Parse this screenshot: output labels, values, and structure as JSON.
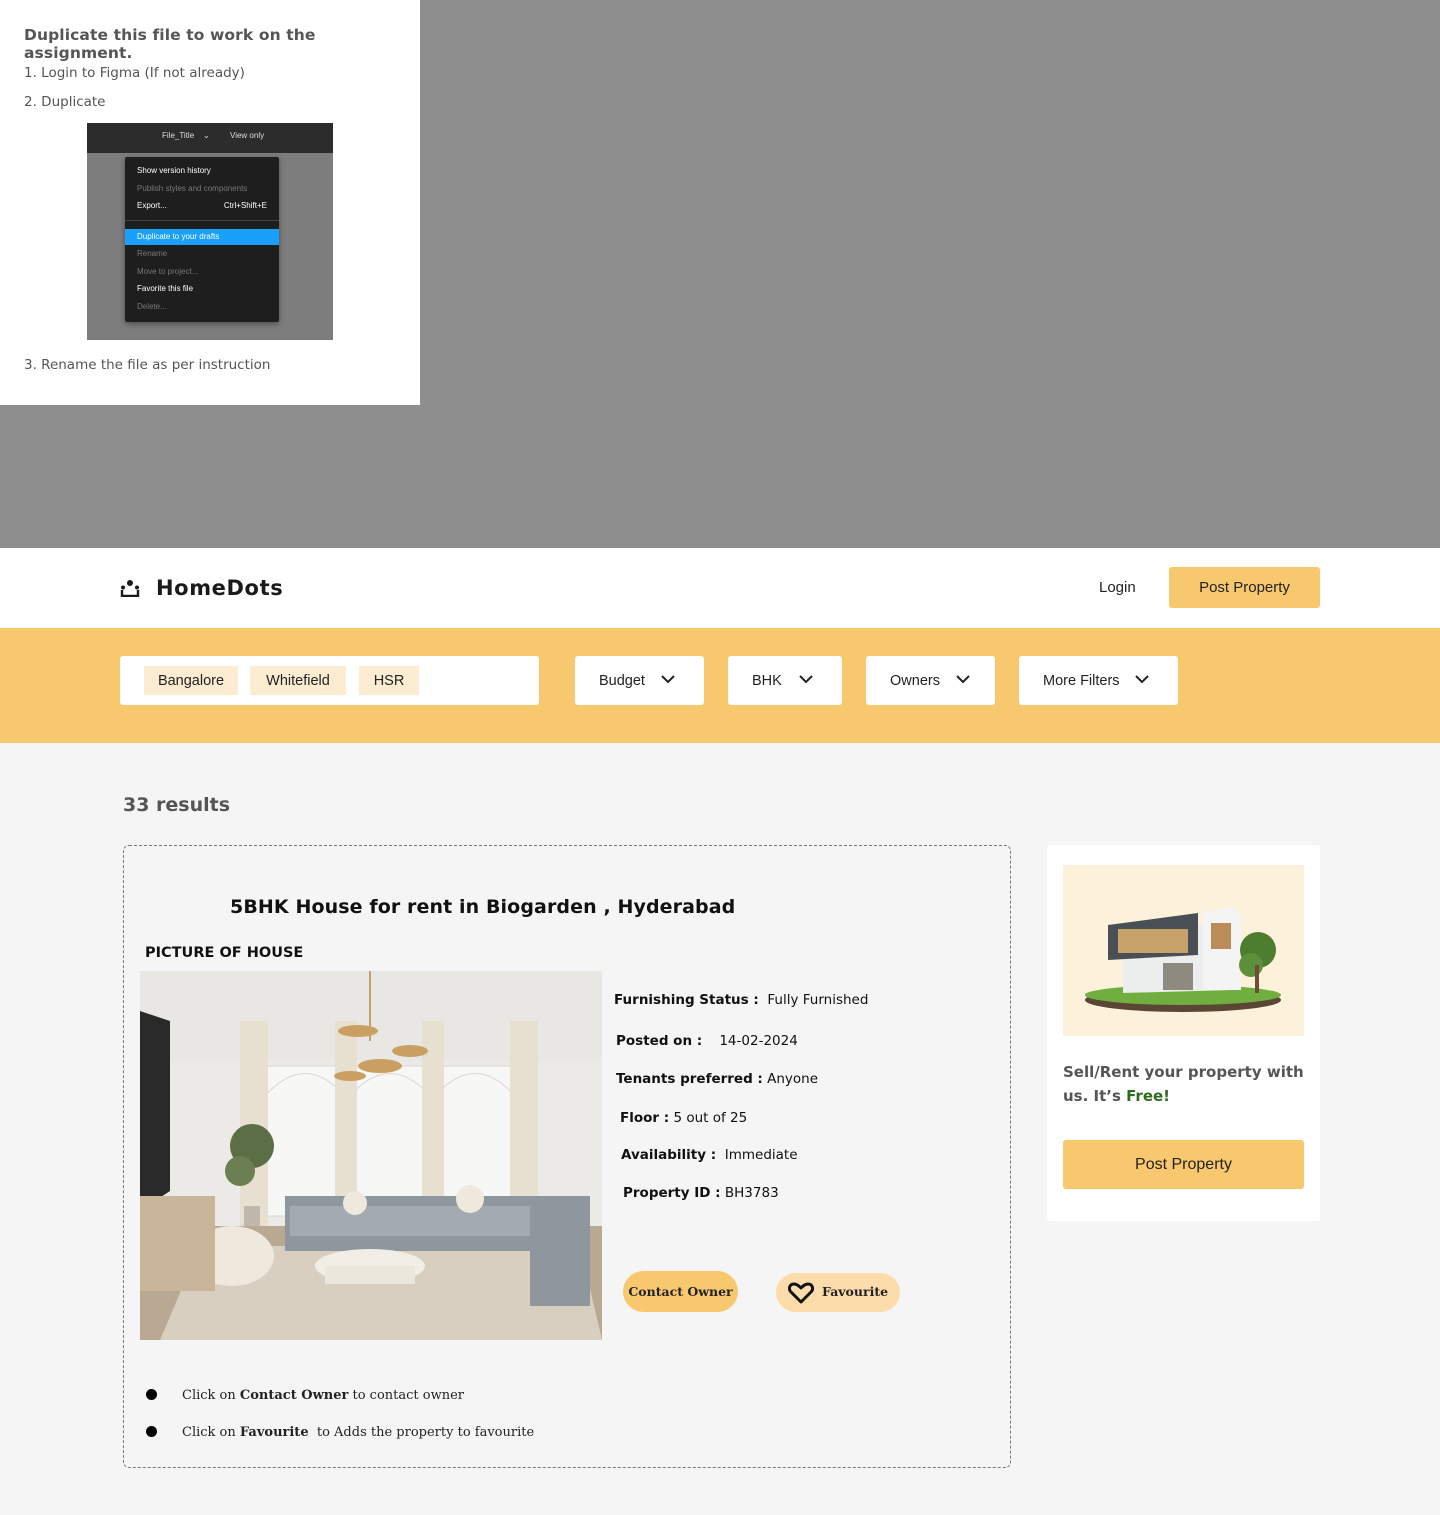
{
  "instructions": {
    "title": "Duplicate this file to work on the assignment.",
    "step1": "1. Login to Figma (If not already)",
    "step2": "2. Duplicate",
    "step3": "3. Rename the file as per instruction",
    "figma_menu": {
      "file_title": "File_Title",
      "view_only": "View only",
      "items": [
        "Show version history",
        "Publish styles and components",
        "Export...",
        "Duplicate to your drafts",
        "Rename",
        "Move to project...",
        "Favorite this file",
        "Delete..."
      ],
      "export_shortcut": "Ctrl+Shift+E"
    }
  },
  "header": {
    "brand": "HomeDots",
    "login_label": "Login",
    "post_property_label": "Post Property"
  },
  "filters": {
    "locations": [
      "Bangalore",
      "Whitefield",
      "HSR"
    ],
    "dropdowns": [
      "Budget",
      "BHK",
      "Owners",
      "More Filters"
    ]
  },
  "results": {
    "count_label": "33 results"
  },
  "listing": {
    "title": "5BHK House for rent in Biogarden , Hyderabad",
    "picture_label": "PICTURE OF HOUSE",
    "details": {
      "furnishing_label": "Furnishing Status :",
      "furnishing_value": "Fully Furnished",
      "posted_label": "Posted on :",
      "posted_value": "14-02-2024",
      "tenants_label": "Tenants preferred :",
      "tenants_value": "Anyone",
      "floor_label": "Floor :",
      "floor_value": "5 out of 25",
      "availability_label": "Availability :",
      "availability_value": "Immediate",
      "property_id_label": "Property ID :",
      "property_id_value": "BH3783"
    },
    "contact_label": "Contact Owner",
    "favourite_label": "Favourite",
    "notes": {
      "n1_pre": "Click on",
      "n1_bold": "Contact Owner",
      "n1_post": "to contact owner",
      "n2_pre": "Click on",
      "n2_bold": "Favourite",
      "n2_post": "to Adds the property to favourite"
    }
  },
  "side_panel": {
    "text": "Sell/Rent your property with us. It’s",
    "free": "Free!",
    "button_label": "Post Property"
  },
  "colors": {
    "accent": "#f8c86f",
    "chip_bg": "#fcecd2",
    "free_green": "#2e6b1f",
    "figma_blue": "#18a0fb"
  }
}
